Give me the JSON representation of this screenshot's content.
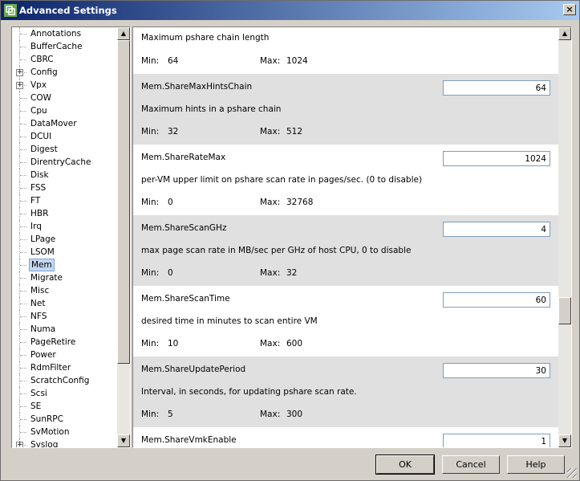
{
  "window": {
    "title": "Advanced Settings",
    "icon": "vmware-icon",
    "close_glyph": "×"
  },
  "tree": {
    "items": [
      {
        "label": "Annotations",
        "expandable": false,
        "selected": false
      },
      {
        "label": "BufferCache",
        "expandable": false,
        "selected": false
      },
      {
        "label": "CBRC",
        "expandable": false,
        "selected": false
      },
      {
        "label": "Config",
        "expandable": true,
        "selected": false
      },
      {
        "label": "Vpx",
        "expandable": true,
        "selected": false
      },
      {
        "label": "COW",
        "expandable": false,
        "selected": false
      },
      {
        "label": "Cpu",
        "expandable": false,
        "selected": false
      },
      {
        "label": "DataMover",
        "expandable": false,
        "selected": false
      },
      {
        "label": "DCUI",
        "expandable": false,
        "selected": false
      },
      {
        "label": "Digest",
        "expandable": false,
        "selected": false
      },
      {
        "label": "DirentryCache",
        "expandable": false,
        "selected": false
      },
      {
        "label": "Disk",
        "expandable": false,
        "selected": false
      },
      {
        "label": "FSS",
        "expandable": false,
        "selected": false
      },
      {
        "label": "FT",
        "expandable": false,
        "selected": false
      },
      {
        "label": "HBR",
        "expandable": false,
        "selected": false
      },
      {
        "label": "Irq",
        "expandable": false,
        "selected": false
      },
      {
        "label": "LPage",
        "expandable": false,
        "selected": false
      },
      {
        "label": "LSOM",
        "expandable": false,
        "selected": false
      },
      {
        "label": "Mem",
        "expandable": false,
        "selected": true
      },
      {
        "label": "Migrate",
        "expandable": false,
        "selected": false
      },
      {
        "label": "Misc",
        "expandable": false,
        "selected": false
      },
      {
        "label": "Net",
        "expandable": false,
        "selected": false
      },
      {
        "label": "NFS",
        "expandable": false,
        "selected": false
      },
      {
        "label": "Numa",
        "expandable": false,
        "selected": false
      },
      {
        "label": "PageRetire",
        "expandable": false,
        "selected": false
      },
      {
        "label": "Power",
        "expandable": false,
        "selected": false
      },
      {
        "label": "RdmFilter",
        "expandable": false,
        "selected": false
      },
      {
        "label": "ScratchConfig",
        "expandable": false,
        "selected": false
      },
      {
        "label": "Scsi",
        "expandable": false,
        "selected": false
      },
      {
        "label": "SE",
        "expandable": false,
        "selected": false
      },
      {
        "label": "SunRPC",
        "expandable": false,
        "selected": false
      },
      {
        "label": "SvMotion",
        "expandable": false,
        "selected": false
      },
      {
        "label": "Syslog",
        "expandable": true,
        "selected": false
      }
    ],
    "expander_glyph": "+"
  },
  "settings": {
    "min_label": "Min:",
    "max_label": "Max:",
    "items": [
      {
        "name": "",
        "description": "Maximum pshare chain length",
        "value": "",
        "min": "64",
        "max": "1024",
        "shaded": false
      },
      {
        "name": "Mem.ShareMaxHintsChain",
        "description": "Maximum hints in a pshare chain",
        "value": "64",
        "min": "32",
        "max": "512",
        "shaded": true
      },
      {
        "name": "Mem.ShareRateMax",
        "description": "per-VM upper limit on pshare scan rate in pages/sec. (0 to disable)",
        "value": "1024",
        "min": "0",
        "max": "32768",
        "shaded": false
      },
      {
        "name": "Mem.ShareScanGHz",
        "description": "max page scan rate in MB/sec per GHz of host CPU, 0 to disable",
        "value": "4",
        "min": "0",
        "max": "32",
        "shaded": true
      },
      {
        "name": "Mem.ShareScanTime",
        "description": "desired time in minutes to scan entire VM",
        "value": "60",
        "min": "10",
        "max": "600",
        "shaded": false
      },
      {
        "name": "Mem.ShareUpdatePeriod",
        "description": "Interval, in seconds, for updating pshare scan rate.",
        "value": "30",
        "min": "5",
        "max": "300",
        "shaded": true
      },
      {
        "name": "Mem.ShareVmkEnable",
        "description": "",
        "value": "1",
        "min": "",
        "max": "",
        "shaded": false
      }
    ]
  },
  "scroll": {
    "up_glyph": "▲",
    "down_glyph": "▼",
    "settings_position_fraction": 0.7
  },
  "buttons": {
    "ok": "OK",
    "cancel": "Cancel",
    "help": "Help"
  }
}
